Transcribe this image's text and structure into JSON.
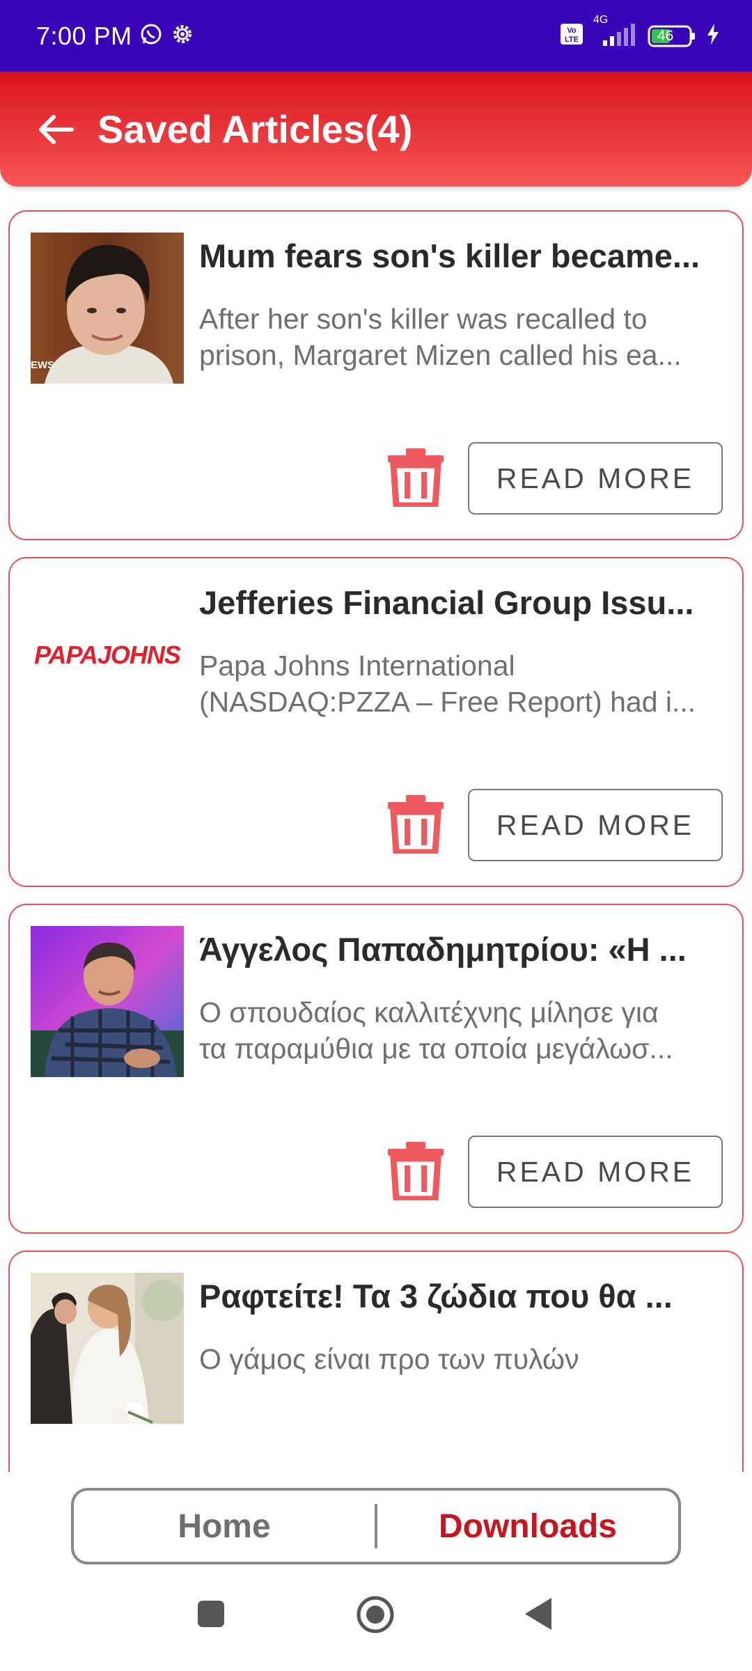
{
  "status_bar": {
    "time": "7:00 PM",
    "icons": [
      "whatsapp-icon",
      "settings-gear-icon",
      "volte-icon",
      "4g-signal-icon",
      "battery-icon",
      "charging-bolt-icon"
    ],
    "network": "4G",
    "battery": "46"
  },
  "app_bar": {
    "title": "Saved Articles(4)",
    "back_icon": "arrow-left-icon"
  },
  "articles": [
    {
      "title": "Mum fears son's killer became...",
      "desc_line1": "After her son's killer was recalled to",
      "desc_line2": "prison, Margaret Mizen called his ea...",
      "thumb_caption": "EWS",
      "read_more": "READ MORE"
    },
    {
      "title": "Jefferies Financial Group Issu...",
      "desc_line1": "Papa Johns International",
      "desc_line2": "(NASDAQ:PZZA – Free Report) had i...",
      "thumb_logo": "PAPAJOHNS",
      "read_more": "READ MORE"
    },
    {
      "title": "Άγγελος Παπαδημητρίου: «Η ...",
      "desc_line1": "Ο σπουδαίος καλλιτέχνης μίλησε για",
      "desc_line2": "τα παραμύθια με τα οποία μεγάλωσ...",
      "read_more": "READ MORE"
    },
    {
      "title": "Ραφτείτε! Τα 3 ζώδια που θα ...",
      "desc_line1": "Ο γάμος είναι προ των πυλών",
      "desc_line2": ""
    }
  ],
  "bottom_nav": {
    "home": "Home",
    "downloads": "Downloads",
    "active": "Downloads"
  },
  "colors": {
    "status_bar": "#3a05b8",
    "app_bar_top": "#d8141c",
    "app_bar_bottom": "#f95658",
    "card_border": "#ef4d55",
    "trash": "#f05a5e",
    "active_tab": "#c8141c"
  }
}
